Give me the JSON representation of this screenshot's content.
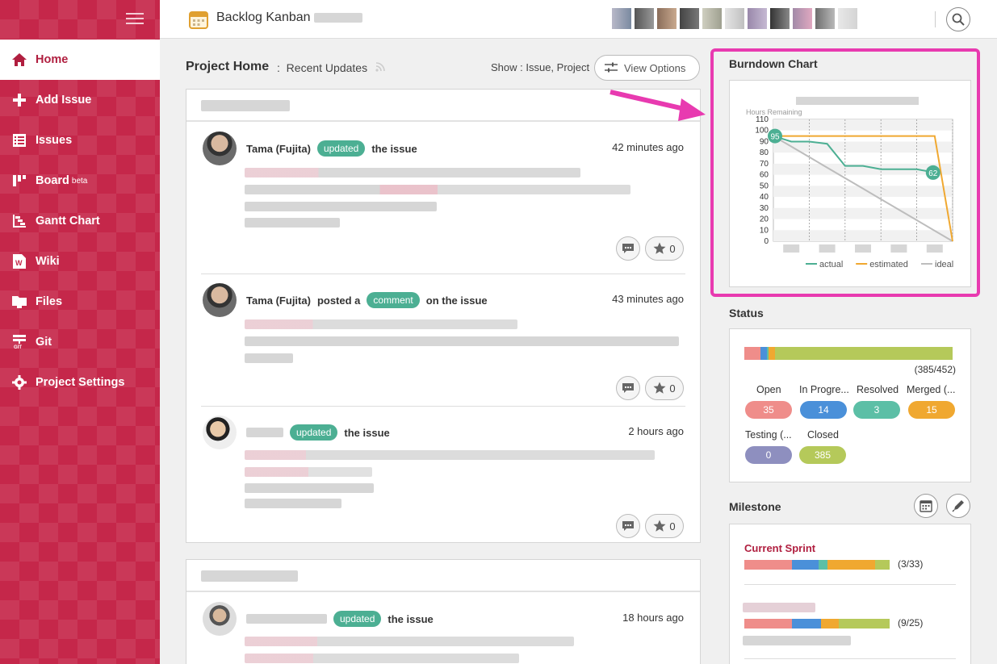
{
  "app": {
    "project_title": "Backlog Kanban"
  },
  "sidebar": {
    "items": [
      {
        "label": "Home",
        "icon": "home-icon"
      },
      {
        "label": "Add Issue",
        "icon": "plus-icon"
      },
      {
        "label": "Issues",
        "icon": "list-icon"
      },
      {
        "label": "Board",
        "sup": "beta",
        "icon": "board-icon"
      },
      {
        "label": "Gantt Chart",
        "icon": "gantt-icon"
      },
      {
        "label": "Wiki",
        "icon": "wiki-icon"
      },
      {
        "label": "Files",
        "icon": "folder-icon"
      },
      {
        "label": "Git",
        "icon": "git-icon"
      },
      {
        "label": "Project Settings",
        "icon": "gear-icon"
      }
    ]
  },
  "main": {
    "title": "Project Home",
    "separator": ":",
    "subtitle": "Recent Updates",
    "show_label": "Show : Issue, Project",
    "view_options": "View Options",
    "updates": [
      {
        "user": "Tama (Fujita)",
        "pre": "",
        "badge": "updated",
        "post": "the issue",
        "time": "42 minutes ago",
        "star_count": "0"
      },
      {
        "user": "Tama (Fujita)",
        "pre": "posted a",
        "badge": "comment",
        "post": "on the issue",
        "time": "43 minutes ago",
        "star_count": "0"
      },
      {
        "user": "",
        "pre": "",
        "badge": "updated",
        "post": "the issue",
        "time": "2 hours ago",
        "star_count": "0"
      },
      {
        "user": "",
        "pre": "",
        "badge": "updated",
        "post": "the issue",
        "time": "18 hours ago",
        "star_count": "0"
      }
    ]
  },
  "burndown": {
    "title": "Burndown Chart",
    "ylabel": "Hours Remaining",
    "legend": {
      "actual": "actual",
      "estimated": "estimated",
      "ideal": "ideal"
    }
  },
  "chart_data": {
    "type": "line",
    "title": "",
    "ylabel": "Hours Remaining",
    "ylim": [
      0,
      110
    ],
    "yticks": [
      0,
      10,
      20,
      30,
      40,
      50,
      60,
      70,
      80,
      90,
      100,
      110
    ],
    "x": [
      0,
      1,
      2,
      3,
      4,
      5,
      6,
      7,
      8,
      9,
      10
    ],
    "series": [
      {
        "name": "actual",
        "color": "#4caf93",
        "values": [
          95,
          90,
          90,
          88,
          68,
          68,
          65,
          65,
          65,
          62,
          null
        ],
        "labels": {
          "0": "95",
          "9": "62"
        }
      },
      {
        "name": "estimated",
        "color": "#f0a830",
        "values": [
          95,
          95,
          95,
          95,
          95,
          95,
          95,
          95,
          95,
          95,
          0
        ]
      },
      {
        "name": "ideal",
        "color": "#bdbdbd",
        "values": [
          95,
          85.5,
          76,
          66.5,
          57,
          47.5,
          38,
          28.5,
          19,
          9.5,
          0
        ]
      }
    ]
  },
  "status": {
    "title": "Status",
    "ratio": "(385/452)",
    "bar": [
      {
        "value": 35,
        "color": "#ef8d8a"
      },
      {
        "value": 14,
        "color": "#4a90d9"
      },
      {
        "value": 3,
        "color": "#5cbfa6"
      },
      {
        "value": 15,
        "color": "#f0a830"
      },
      {
        "value": 0,
        "color": "#8e8fbf"
      },
      {
        "value": 385,
        "color": "#b5c95a"
      }
    ],
    "items": [
      {
        "label": "Open",
        "count": "35",
        "color": "#ef8d8a"
      },
      {
        "label": "In Progre...",
        "count": "14",
        "color": "#4a90d9"
      },
      {
        "label": "Resolved",
        "count": "3",
        "color": "#5cbfa6"
      },
      {
        "label": "Merged (...",
        "count": "15",
        "color": "#f0a830"
      },
      {
        "label": "Testing (...",
        "count": "0",
        "color": "#8e8fbf"
      },
      {
        "label": "Closed",
        "count": "385",
        "color": "#b5c95a"
      }
    ]
  },
  "milestone": {
    "title": "Milestone",
    "current_sprint": "Current Sprint",
    "sprint_ratio": "(3/33)",
    "second_ratio": "(9/25)"
  }
}
